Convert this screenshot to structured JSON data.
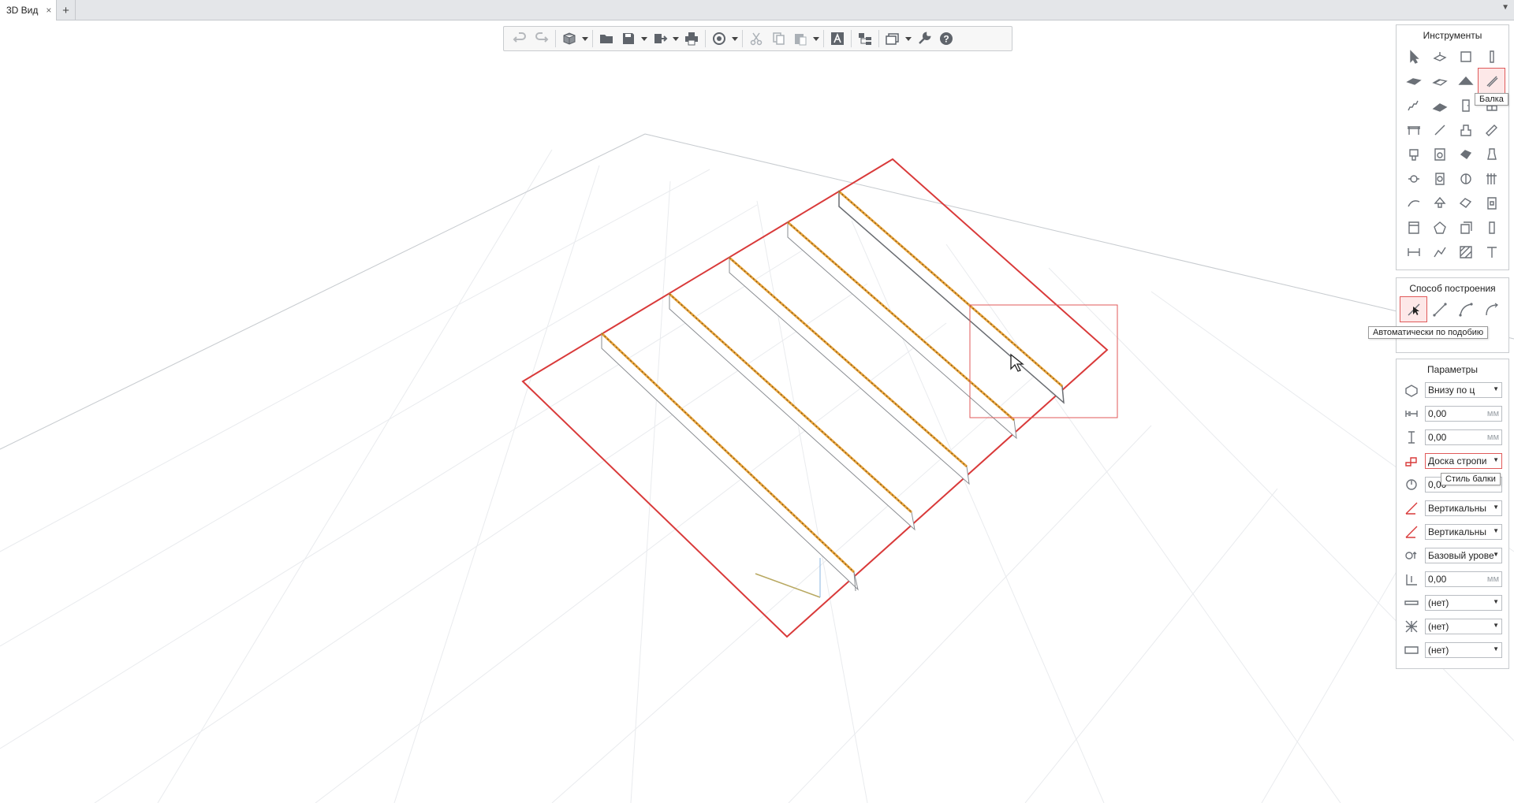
{
  "tabs": {
    "active_label": "3D Вид",
    "close_icon": "×",
    "add_icon": "+",
    "menu_icon": "▼"
  },
  "toolbar": {
    "buttons": [
      "undo-icon",
      "redo-icon",
      "3d-view-icon",
      "open-folder-icon",
      "save-icon",
      "export-icon",
      "print-icon",
      "render-icon",
      "cut-icon",
      "copy-icon",
      "paste-icon",
      "text-style-icon",
      "layers-icon",
      "views-icon",
      "wrench-icon",
      "help-icon"
    ]
  },
  "tools_panel": {
    "title": "Инструменты",
    "selected_tooltip": "Балка"
  },
  "construction_panel": {
    "title": "Способ построения",
    "selected_tooltip": "Автоматически по подобию"
  },
  "params_panel": {
    "title": "Параметры",
    "fields": [
      {
        "value": "Внизу по ц",
        "kind": "select"
      },
      {
        "value": "0,00",
        "unit": "мм",
        "kind": "number"
      },
      {
        "value": "0,00",
        "unit": "мм",
        "kind": "number"
      },
      {
        "value": "Доска стропи",
        "kind": "select"
      },
      {
        "value": "0,00",
        "kind": "number"
      },
      {
        "value": "Вертикальны",
        "kind": "select"
      },
      {
        "value": "Вертикальны",
        "kind": "select"
      },
      {
        "value": "Базовый урове",
        "kind": "select"
      },
      {
        "value": "0,00",
        "unit": "мм",
        "kind": "number"
      },
      {
        "value": "(нет)",
        "kind": "select"
      },
      {
        "value": "(нет)",
        "kind": "select"
      },
      {
        "value": "(нет)",
        "kind": "select"
      }
    ],
    "style_tooltip": "Стиль балки"
  },
  "colors": {
    "accent_red": "#d93a3a",
    "beam_orange": "#e8a33a",
    "icon_gray": "#6b7077"
  }
}
